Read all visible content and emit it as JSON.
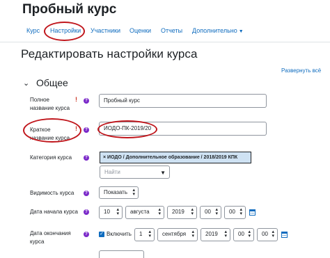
{
  "header": {
    "course_title": "Пробный курс"
  },
  "tabs": [
    {
      "label": "Курс"
    },
    {
      "label": "Настройки"
    },
    {
      "label": "Участники"
    },
    {
      "label": "Оценки"
    },
    {
      "label": "Отчеты"
    },
    {
      "label": "Дополнительно"
    }
  ],
  "page": {
    "heading": "Редактировать настройки курса",
    "expand_all": "Развернуть всё"
  },
  "section": {
    "title": "Общее"
  },
  "form": {
    "fullname": {
      "label_line1": "Полное",
      "label_line2": "название курса",
      "value": "Пробный курс"
    },
    "shortname": {
      "label_line1": "Краткое",
      "label_line2": "название курса",
      "value": "ИОДО-ПК-2019/20"
    },
    "category": {
      "label": "Категория курса",
      "selected": "× ИОДО / Дополнительное образование / 2018/2019 КПК",
      "search_placeholder": "Найти"
    },
    "visibility": {
      "label": "Видимость курса",
      "value": "Показать"
    },
    "start_date": {
      "label": "Дата начала курса",
      "day": "10",
      "month": "августа",
      "year": "2019",
      "hour": "00",
      "minute": "00"
    },
    "end_date": {
      "label_line1": "Дата окончания",
      "label_line2": "курса",
      "enable_label": "Включить",
      "day": "1",
      "month": "сентября",
      "year": "2019",
      "hour": "00",
      "minute": "00"
    }
  },
  "icons": {
    "required": "exclamation-icon",
    "help": "question-icon",
    "calendar": "calendar-icon"
  },
  "colors": {
    "link": "#0f6cbf",
    "required": "#ca3120",
    "help": "#7b2ac9",
    "annotation": "#c0161c"
  }
}
